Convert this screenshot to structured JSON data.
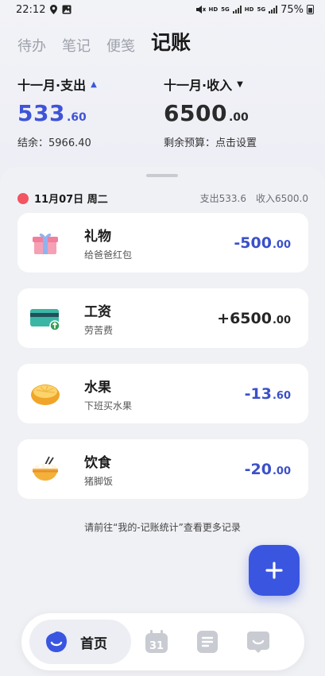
{
  "status_bar": {
    "time": "22:12",
    "hd1": "HD",
    "net5g_1": "5G",
    "hd2": "HD",
    "net5g_2": "5G",
    "battery_text": "75%"
  },
  "tabs": [
    {
      "label": "待办",
      "active": false
    },
    {
      "label": "笔记",
      "active": false
    },
    {
      "label": "便笺",
      "active": false
    },
    {
      "label": "记账",
      "active": true
    }
  ],
  "summary": {
    "expense_label": "十一月·支出",
    "expense_int": "533",
    "expense_dec": ".60",
    "balance_text": "结余：5966.40",
    "income_label": "十一月·收入",
    "income_int": "6500",
    "income_dec": ".00",
    "budget_text": "剩余预算：点击设置"
  },
  "day": {
    "date_text": "11月07日 周二",
    "expense_text": "支出533.6",
    "income_text": "收入6500.0"
  },
  "records": [
    {
      "category": "礼物",
      "note": "给爸爸红包",
      "amount_int": "-500",
      "amount_dec": ".00",
      "icon": "gift-icon"
    },
    {
      "category": "工资",
      "note": "劳苦费",
      "amount_int": "+6500",
      "amount_dec": ".00",
      "icon": "salary-card-icon"
    },
    {
      "category": "水果",
      "note": "下班买水果",
      "amount_int": "-13",
      "amount_dec": ".60",
      "icon": "orange-icon"
    },
    {
      "category": "饮食",
      "note": "猪脚饭",
      "amount_int": "-20",
      "amount_dec": ".00",
      "icon": "rice-bowl-icon"
    }
  ],
  "hint": "请前往“我的-记账统计”查看更多记录",
  "bottom_nav": {
    "home_label": "首页",
    "calendar_day": "31"
  },
  "colors": {
    "accent": "#3a56e0",
    "expense_amount": "#3b50c9",
    "date_dot": "#f25560"
  }
}
